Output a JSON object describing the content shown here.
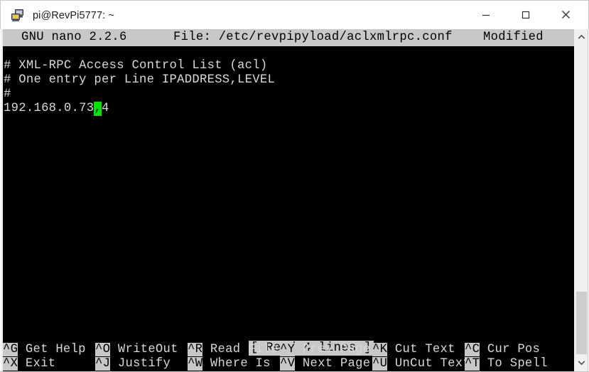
{
  "window": {
    "title": "pi@RevPi5777: ~",
    "icon": "putty-terminal-icon",
    "controls": {
      "minimize": "minimize-button",
      "maximize": "maximize-button",
      "close": "close-button"
    }
  },
  "nano": {
    "version_label": "GNU nano 2.2.6",
    "file_label": "File: /etc/revpipyload/aclxmlrpc.conf",
    "modified_label": "Modified",
    "lines": [
      "# XML-RPC Access Control List (acl)",
      "# One entry per Line IPADDRESS,LEVEL",
      "#"
    ],
    "entry_line": {
      "before_cursor": "192.168.0.73",
      "cursor_char": ",",
      "after_cursor": "4"
    },
    "status_message": "[ Read 4 lines ]",
    "shortcuts_row1": [
      {
        "key": "^G",
        "label": "Get Help"
      },
      {
        "key": "^O",
        "label": "WriteOut"
      },
      {
        "key": "^R",
        "label": "Read File"
      },
      {
        "key": "^Y",
        "label": "Prev Page"
      },
      {
        "key": "^K",
        "label": "Cut Text"
      },
      {
        "key": "^C",
        "label": "Cur Pos"
      }
    ],
    "shortcuts_row2": [
      {
        "key": "^X",
        "label": "Exit"
      },
      {
        "key": "^J",
        "label": "Justify"
      },
      {
        "key": "^W",
        "label": "Where Is"
      },
      {
        "key": "^V",
        "label": "Next Page"
      },
      {
        "key": "^U",
        "label": "UnCut Text"
      },
      {
        "key": "^T",
        "label": "To Spell"
      }
    ]
  },
  "scrollbar": {
    "up_arrow": "scroll-up-icon",
    "down_arrow": "scroll-down-icon"
  },
  "colors": {
    "terminal_bg": "#000000",
    "terminal_fg": "#d8d8d8",
    "inverse_bg": "#c8c8c8",
    "cursor_green": "#00e400"
  }
}
